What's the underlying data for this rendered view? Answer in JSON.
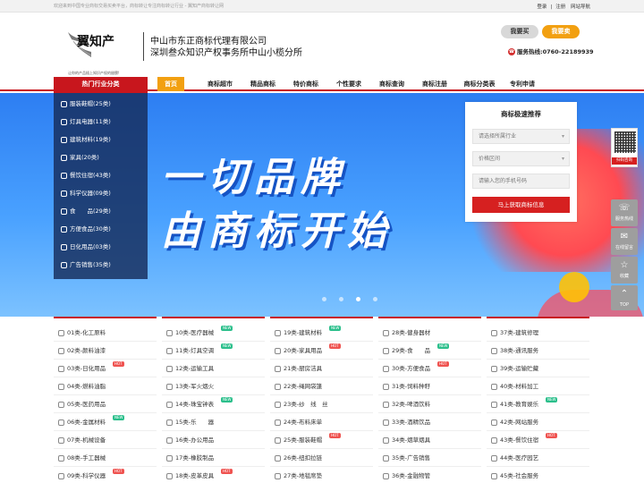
{
  "topbar": {
    "welcome": "欢迎来到中国专业商标交易买卖平台，商标转让专注商标转让行业 - 翼知产商标转让网",
    "login": "登录",
    "sep": "|",
    "register": "注册",
    "sitemap": "网站导航"
  },
  "header": {
    "brand": "翼知产",
    "slogan": "让你的产品插上知识产权的翅膀!",
    "company_line1": "中山市东正商标代理有限公司",
    "company_line2": "深圳叁众知识产权事务所中山小榄分所",
    "buy_label": "我要买",
    "sell_label": "我要卖",
    "hotline_label": "服务热线:",
    "hotline_number": "0760-22189939"
  },
  "nav": {
    "hot_label": "热门行业分类",
    "items": [
      {
        "label": "首页"
      },
      {
        "label": "商标超市"
      },
      {
        "label": "精品商标"
      },
      {
        "label": "特价商标"
      },
      {
        "label": "个性要求"
      },
      {
        "label": "商标查询"
      },
      {
        "label": "商标注册"
      },
      {
        "label": "商标分类表"
      },
      {
        "label": "专利申请"
      }
    ]
  },
  "banner": {
    "line1": "一切品牌",
    "line2": "由商标开始"
  },
  "categories": [
    {
      "label": "服装鞋帽(25类)"
    },
    {
      "label": "灯具电器(11类)"
    },
    {
      "label": "建筑材料(19类)"
    },
    {
      "label": "家具(20类)"
    },
    {
      "label": "餐饮住宿(43类)"
    },
    {
      "label": "科学仪器(09类)"
    },
    {
      "label": "食　　品(29类)"
    },
    {
      "label": "方便食品(30类)"
    },
    {
      "label": "日化用品(03类)"
    },
    {
      "label": "广告销售(35类)"
    }
  ],
  "recommend": {
    "title": "商标极速推荐",
    "industry_placeholder": "请选择所属行业",
    "price_placeholder": "价格区间",
    "phone_placeholder": "请输入您的手机号码",
    "submit_label": "马上获取商标信息"
  },
  "side": {
    "qr_label": "扫码咨询",
    "items": [
      {
        "label": "服务热线"
      },
      {
        "label": "在线留言"
      },
      {
        "label": "收藏"
      },
      {
        "label": "TOP"
      }
    ]
  },
  "classes": [
    [
      {
        "label": "01类-化工原料",
        "badge": ""
      },
      {
        "label": "02类-颜料油漆",
        "badge": ""
      },
      {
        "label": "03类-日化用品",
        "badge": "HOT"
      },
      {
        "label": "04类-燃料油脂",
        "badge": ""
      },
      {
        "label": "05类-医药用品",
        "badge": ""
      },
      {
        "label": "06类-金属材料",
        "badge": "NEW"
      },
      {
        "label": "07类-机械设备",
        "badge": ""
      },
      {
        "label": "08类-手工器械",
        "badge": ""
      },
      {
        "label": "09类-科学仪器",
        "badge": "HOT"
      }
    ],
    [
      {
        "label": "10类-医疗器械",
        "badge": "NEW"
      },
      {
        "label": "11类-灯具空调",
        "badge": "NEW"
      },
      {
        "label": "12类-运输工具",
        "badge": ""
      },
      {
        "label": "13类-军火烟火",
        "badge": ""
      },
      {
        "label": "14类-珠宝钟表",
        "badge": "NEW"
      },
      {
        "label": "15类-乐　　器",
        "badge": ""
      },
      {
        "label": "16类-办公用品",
        "badge": ""
      },
      {
        "label": "17类-橡胶制品",
        "badge": ""
      },
      {
        "label": "18类-皮革皮具",
        "badge": "HOT"
      }
    ],
    [
      {
        "label": "19类-建筑材料",
        "badge": "NEW"
      },
      {
        "label": "20类-家具用品",
        "badge": "HOT"
      },
      {
        "label": "21类-厨房洁具",
        "badge": ""
      },
      {
        "label": "22类-绳网袋篷",
        "badge": ""
      },
      {
        "label": "23类-纱　线　丝",
        "badge": ""
      },
      {
        "label": "24类-布料床单",
        "badge": ""
      },
      {
        "label": "25类-服装鞋帽",
        "badge": "HOT"
      },
      {
        "label": "26类-纽扣拉链",
        "badge": ""
      },
      {
        "label": "27类-地毯席垫",
        "badge": ""
      }
    ],
    [
      {
        "label": "28类-健身器材",
        "badge": ""
      },
      {
        "label": "29类-食　　品",
        "badge": "NEW"
      },
      {
        "label": "30类-方便食品",
        "badge": "HOT"
      },
      {
        "label": "31类-饲料种籽",
        "badge": ""
      },
      {
        "label": "32类-啤酒饮料",
        "badge": ""
      },
      {
        "label": "33类-酒精饮品",
        "badge": ""
      },
      {
        "label": "34类-烟草烟具",
        "badge": ""
      },
      {
        "label": "35类-广告销售",
        "badge": ""
      },
      {
        "label": "36类-金融物管",
        "badge": ""
      }
    ],
    [
      {
        "label": "37类-建筑修理",
        "badge": ""
      },
      {
        "label": "38类-通讯服务",
        "badge": ""
      },
      {
        "label": "39类-运输贮藏",
        "badge": ""
      },
      {
        "label": "40类-材料加工",
        "badge": ""
      },
      {
        "label": "41类-教育娱乐",
        "badge": "NEW"
      },
      {
        "label": "42类-网站服务",
        "badge": ""
      },
      {
        "label": "43类-餐饮住宿",
        "badge": "HOT"
      },
      {
        "label": "44类-医疗园艺",
        "badge": ""
      },
      {
        "label": "45类-社会服务",
        "badge": ""
      }
    ]
  ],
  "colors": {
    "primary": "#c8161d",
    "accent": "#f2a011",
    "banner": "#2d7ef2"
  }
}
